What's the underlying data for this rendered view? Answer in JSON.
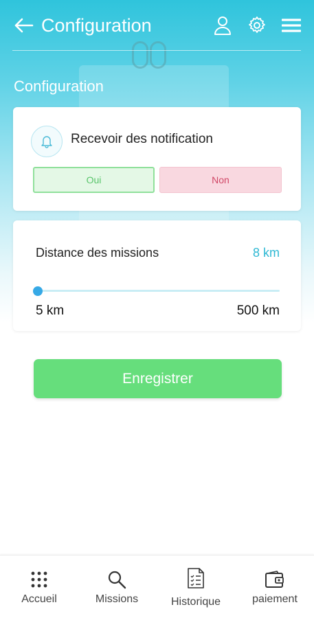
{
  "header": {
    "title": "Configuration",
    "icons": [
      "back-arrow-icon",
      "user-icon",
      "gear-icon",
      "menu-icon"
    ]
  },
  "section_title": "Configuration",
  "notifications": {
    "label": "Recevoir des notification",
    "icon": "bell-icon",
    "yes_label": "Oui",
    "no_label": "Non",
    "selected": "Oui"
  },
  "distance": {
    "label": "Distance des missions",
    "value": "8 km",
    "min_label": "5 km",
    "max_label": "500 km",
    "min": 5,
    "max": 500,
    "current": 8
  },
  "save_label": "Enregistrer",
  "nav": [
    {
      "label": "Accueil",
      "icon": "grid-icon"
    },
    {
      "label": "Missions",
      "icon": "search-icon"
    },
    {
      "label": "Historique",
      "icon": "checklist-document-icon"
    },
    {
      "label": "paiement",
      "icon": "wallet-icon"
    }
  ],
  "colors": {
    "header_gradient_top": "#2fc4dc",
    "accent": "#2eb8d3",
    "save_button": "#66de7c",
    "yes_bg": "#e4f8e6",
    "no_bg": "#f9d8e0"
  }
}
